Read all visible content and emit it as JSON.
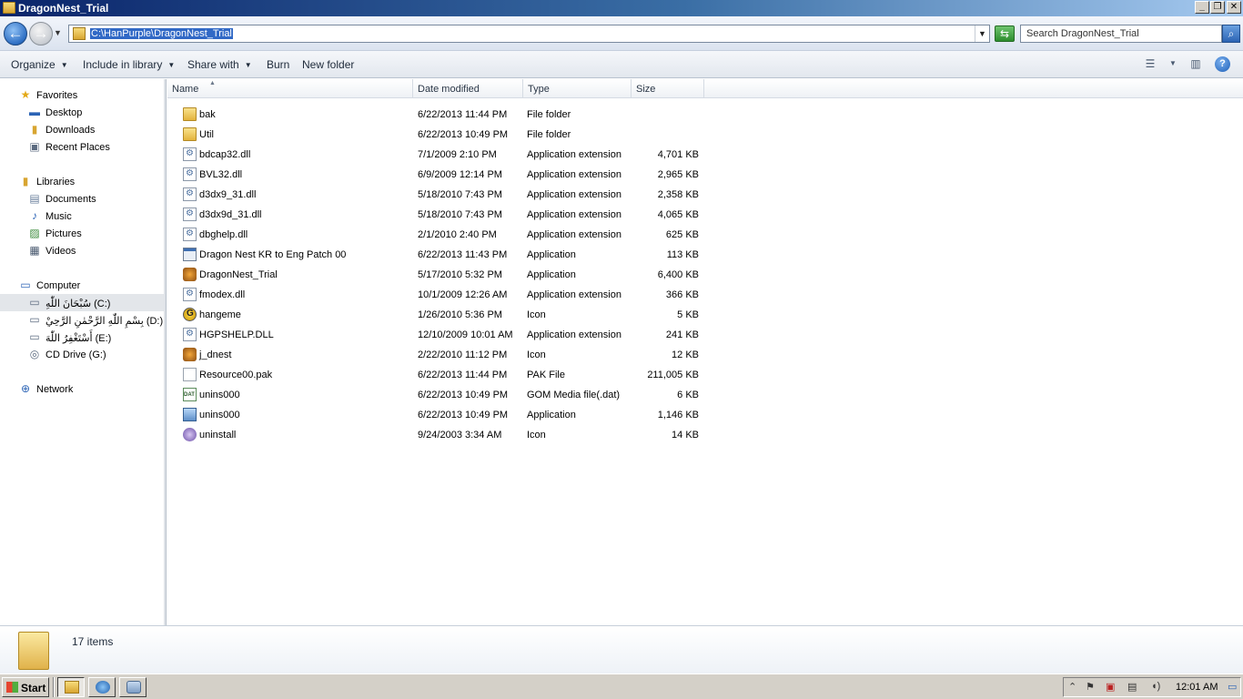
{
  "window": {
    "title": "DragonNest_Trial"
  },
  "address": {
    "path": "C:\\HanPurple\\DragonNest_Trial",
    "search_placeholder": "Search DragonNest_Trial"
  },
  "toolbar": {
    "organize": "Organize",
    "include": "Include in library",
    "share": "Share with",
    "burn": "Burn",
    "new_folder": "New folder"
  },
  "nav": {
    "favorites": "Favorites",
    "desktop": "Desktop",
    "downloads": "Downloads",
    "recent": "Recent Places",
    "libraries": "Libraries",
    "documents": "Documents",
    "music": "Music",
    "pictures": "Pictures",
    "videos": "Videos",
    "computer": "Computer",
    "drive_c": "سُبْحَانَ اللّٰهِ (C:)",
    "drive_d": "بِسْمِ اللّٰهِ الرَّحْمٰنِ الرَّحِيْ (D:)",
    "drive_e": "أَسْتَغْفِرُ اللّٰهَ (E:)",
    "drive_g": "CD Drive (G:)",
    "network": "Network"
  },
  "columns": {
    "name": "Name",
    "date": "Date modified",
    "type": "Type",
    "size": "Size"
  },
  "files": [
    {
      "name": "bak",
      "date": "6/22/2013 11:44 PM",
      "type": "File folder",
      "size": ""
    },
    {
      "name": "Util",
      "date": "6/22/2013 10:49 PM",
      "type": "File folder",
      "size": ""
    },
    {
      "name": "bdcap32.dll",
      "date": "7/1/2009 2:10 PM",
      "type": "Application extension",
      "size": "4,701 KB"
    },
    {
      "name": "BVL32.dll",
      "date": "6/9/2009 12:14 PM",
      "type": "Application extension",
      "size": "2,965 KB"
    },
    {
      "name": "d3dx9_31.dll",
      "date": "5/18/2010 7:43 PM",
      "type": "Application extension",
      "size": "2,358 KB"
    },
    {
      "name": "d3dx9d_31.dll",
      "date": "5/18/2010 7:43 PM",
      "type": "Application extension",
      "size": "4,065 KB"
    },
    {
      "name": "dbghelp.dll",
      "date": "2/1/2010 2:40 PM",
      "type": "Application extension",
      "size": "625 KB"
    },
    {
      "name": "Dragon Nest KR to Eng Patch 00",
      "date": "6/22/2013 11:43 PM",
      "type": "Application",
      "size": "113 KB"
    },
    {
      "name": "DragonNest_Trial",
      "date": "5/17/2010 5:32 PM",
      "type": "Application",
      "size": "6,400 KB"
    },
    {
      "name": "fmodex.dll",
      "date": "10/1/2009 12:26 AM",
      "type": "Application extension",
      "size": "366 KB"
    },
    {
      "name": "hangeme",
      "date": "1/26/2010 5:36 PM",
      "type": "Icon",
      "size": "5 KB"
    },
    {
      "name": "HGPSHELP.DLL",
      "date": "12/10/2009 10:01 AM",
      "type": "Application extension",
      "size": "241 KB"
    },
    {
      "name": "j_dnest",
      "date": "2/22/2010 11:12 PM",
      "type": "Icon",
      "size": "12 KB"
    },
    {
      "name": "Resource00.pak",
      "date": "6/22/2013 11:44 PM",
      "type": "PAK File",
      "size": "211,005 KB"
    },
    {
      "name": "unins000",
      "date": "6/22/2013 10:49 PM",
      "type": "GOM Media file(.dat)",
      "size": "6 KB"
    },
    {
      "name": "unins000",
      "date": "6/22/2013 10:49 PM",
      "type": "Application",
      "size": "1,146 KB"
    },
    {
      "name": "uninstall",
      "date": "9/24/2003 3:34 AM",
      "type": "Icon",
      "size": "14 KB"
    }
  ],
  "status": {
    "count": "17 items"
  },
  "taskbar": {
    "start": "Start",
    "clock": "12:01 AM"
  }
}
